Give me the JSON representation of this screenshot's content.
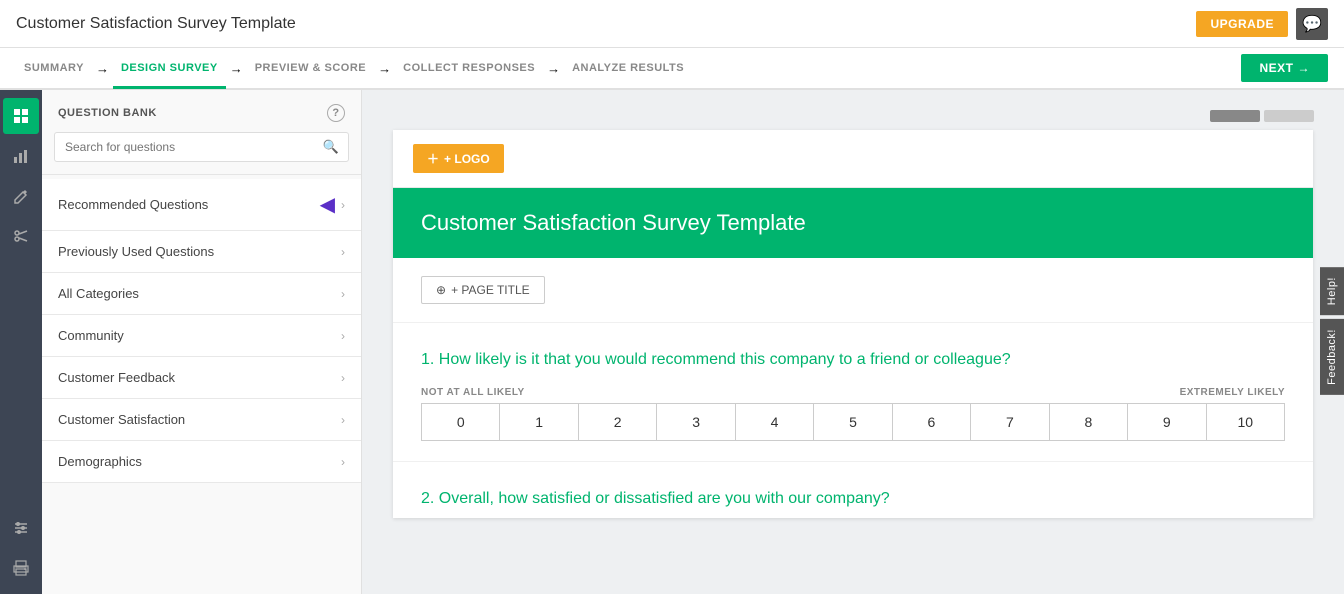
{
  "app": {
    "title": "Customer Satisfaction Survey Template"
  },
  "topbar": {
    "upgrade_label": "UPGRADE",
    "chat_icon": "💬"
  },
  "nav": {
    "steps": [
      {
        "id": "summary",
        "label": "SUMMARY",
        "active": false
      },
      {
        "id": "design",
        "label": "DESIGN SURVEY",
        "active": true
      },
      {
        "id": "preview",
        "label": "PREVIEW & SCORE",
        "active": false
      },
      {
        "id": "collect",
        "label": "COLLECT RESPONSES",
        "active": false
      },
      {
        "id": "analyze",
        "label": "ANALYZE RESULTS",
        "active": false
      }
    ],
    "next_label": "NEXT"
  },
  "icon_nav": [
    {
      "id": "layers",
      "icon": "▦",
      "active": true
    },
    {
      "id": "chart",
      "icon": "📊",
      "active": false
    },
    {
      "id": "pencil",
      "icon": "✏",
      "active": false
    },
    {
      "id": "scissors",
      "icon": "✂",
      "active": false
    },
    {
      "id": "sliders",
      "icon": "⊞",
      "active": false
    },
    {
      "id": "print",
      "icon": "🖨",
      "active": false
    }
  ],
  "question_bank": {
    "title": "QUESTION BANK",
    "help_label": "?",
    "search_placeholder": "Search for questions",
    "categories": [
      {
        "id": "recommended",
        "label": "Recommended Questions",
        "has_arrow": true
      },
      {
        "id": "previously-used",
        "label": "Previously Used Questions",
        "has_arrow": false
      },
      {
        "id": "all-categories",
        "label": "All Categories",
        "has_arrow": false
      },
      {
        "id": "community",
        "label": "Community",
        "has_arrow": false
      },
      {
        "id": "customer-feedback",
        "label": "Customer Feedback",
        "has_arrow": false
      },
      {
        "id": "customer-satisfaction",
        "label": "Customer Satisfaction",
        "has_arrow": false
      },
      {
        "id": "demographics",
        "label": "Demographics",
        "has_arrow": false
      }
    ]
  },
  "survey": {
    "logo_label": "+ LOGO",
    "header_title": "Customer Satisfaction Survey Template",
    "page_title_label": "+ PAGE TITLE",
    "questions": [
      {
        "id": "q1",
        "number": "1",
        "text": "How likely is it that you would recommend this company to a friend or colleague?",
        "type": "nps",
        "labels": {
          "left": "NOT AT ALL LIKELY",
          "right": "EXTREMELY LIKELY"
        },
        "nps_values": [
          "0",
          "1",
          "2",
          "3",
          "4",
          "5",
          "6",
          "7",
          "8",
          "9",
          "10"
        ]
      },
      {
        "id": "q2",
        "number": "2",
        "text": "Overall, how satisfied or dissatisfied are you with our company?"
      }
    ]
  },
  "side_tabs": {
    "help_label": "Help!",
    "feedback_label": "Feedback!"
  },
  "colors": {
    "green": "#00b46e",
    "orange": "#f5a623",
    "dark_nav": "#3d4554",
    "arrow_purple": "#5b2fc7"
  }
}
